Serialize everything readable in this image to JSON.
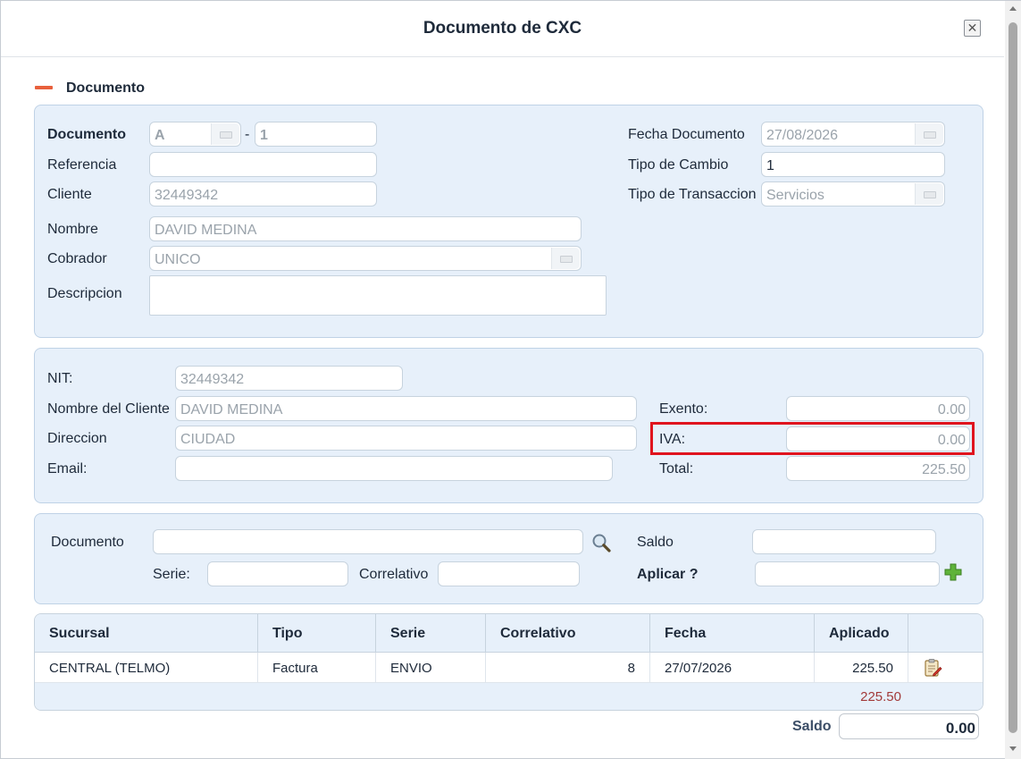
{
  "dialog": {
    "title": "Documento de CXC",
    "close_symbol": "✕"
  },
  "section": {
    "title": "Documento"
  },
  "doc": {
    "documento_label": "Documento",
    "serie_value": "A",
    "separator": "-",
    "numero_value": "1",
    "referencia_label": "Referencia",
    "referencia_value": "",
    "cliente_label": "Cliente",
    "cliente_value": "32449342",
    "nombre_label": "Nombre",
    "nombre_value": "DAVID MEDINA",
    "cobrador_label": "Cobrador",
    "cobrador_value": "UNICO",
    "descripcion_label": "Descripcion",
    "descripcion_value": "",
    "fecha_label": "Fecha Documento",
    "fecha_value": "27/08/2026",
    "tipo_cambio_label": "Tipo de Cambio",
    "tipo_cambio_value": "1",
    "tipo_transaccion_label": "Tipo de Transaccion",
    "tipo_transaccion_value": "Servicios"
  },
  "fiscal": {
    "nit_label": "NIT:",
    "nit_value": "32449342",
    "nombre_cliente_label": "Nombre del Cliente",
    "nombre_cliente_value": "DAVID MEDINA",
    "direccion_label": "Direccion",
    "direccion_value": "CIUDAD",
    "email_label": "Email:",
    "email_value": "",
    "exento_label": "Exento:",
    "exento_value": "0.00",
    "iva_label": "IVA:",
    "iva_value": "0.00",
    "total_label": "Total:",
    "total_value": "225.50"
  },
  "apply": {
    "documento_label": "Documento",
    "documento_value": "",
    "serie_label": "Serie:",
    "serie_value": "",
    "correlativo_label": "Correlativo",
    "correlativo_value": "",
    "saldo_label": "Saldo",
    "saldo_value": "",
    "aplicar_label": "Aplicar ?",
    "aplicar_value": ""
  },
  "grid": {
    "columns": [
      "Sucursal",
      "Tipo",
      "Serie",
      "Correlativo",
      "Fecha",
      "Aplicado"
    ],
    "rows": [
      {
        "sucursal": "CENTRAL (TELMO)",
        "tipo": "Factura",
        "serie": "ENVIO",
        "correlativo": "8",
        "fecha": "27/07/2026",
        "aplicado": "225.50"
      }
    ],
    "total_aplicado": "225.50"
  },
  "footer": {
    "saldo_label": "Saldo",
    "saldo_value": "0.00"
  },
  "colors": {
    "accent_highlight": "#e0141e",
    "panel_bg": "#e7f0fa",
    "collapse_icon": "#e8603c",
    "total_text": "#a23a3a"
  }
}
